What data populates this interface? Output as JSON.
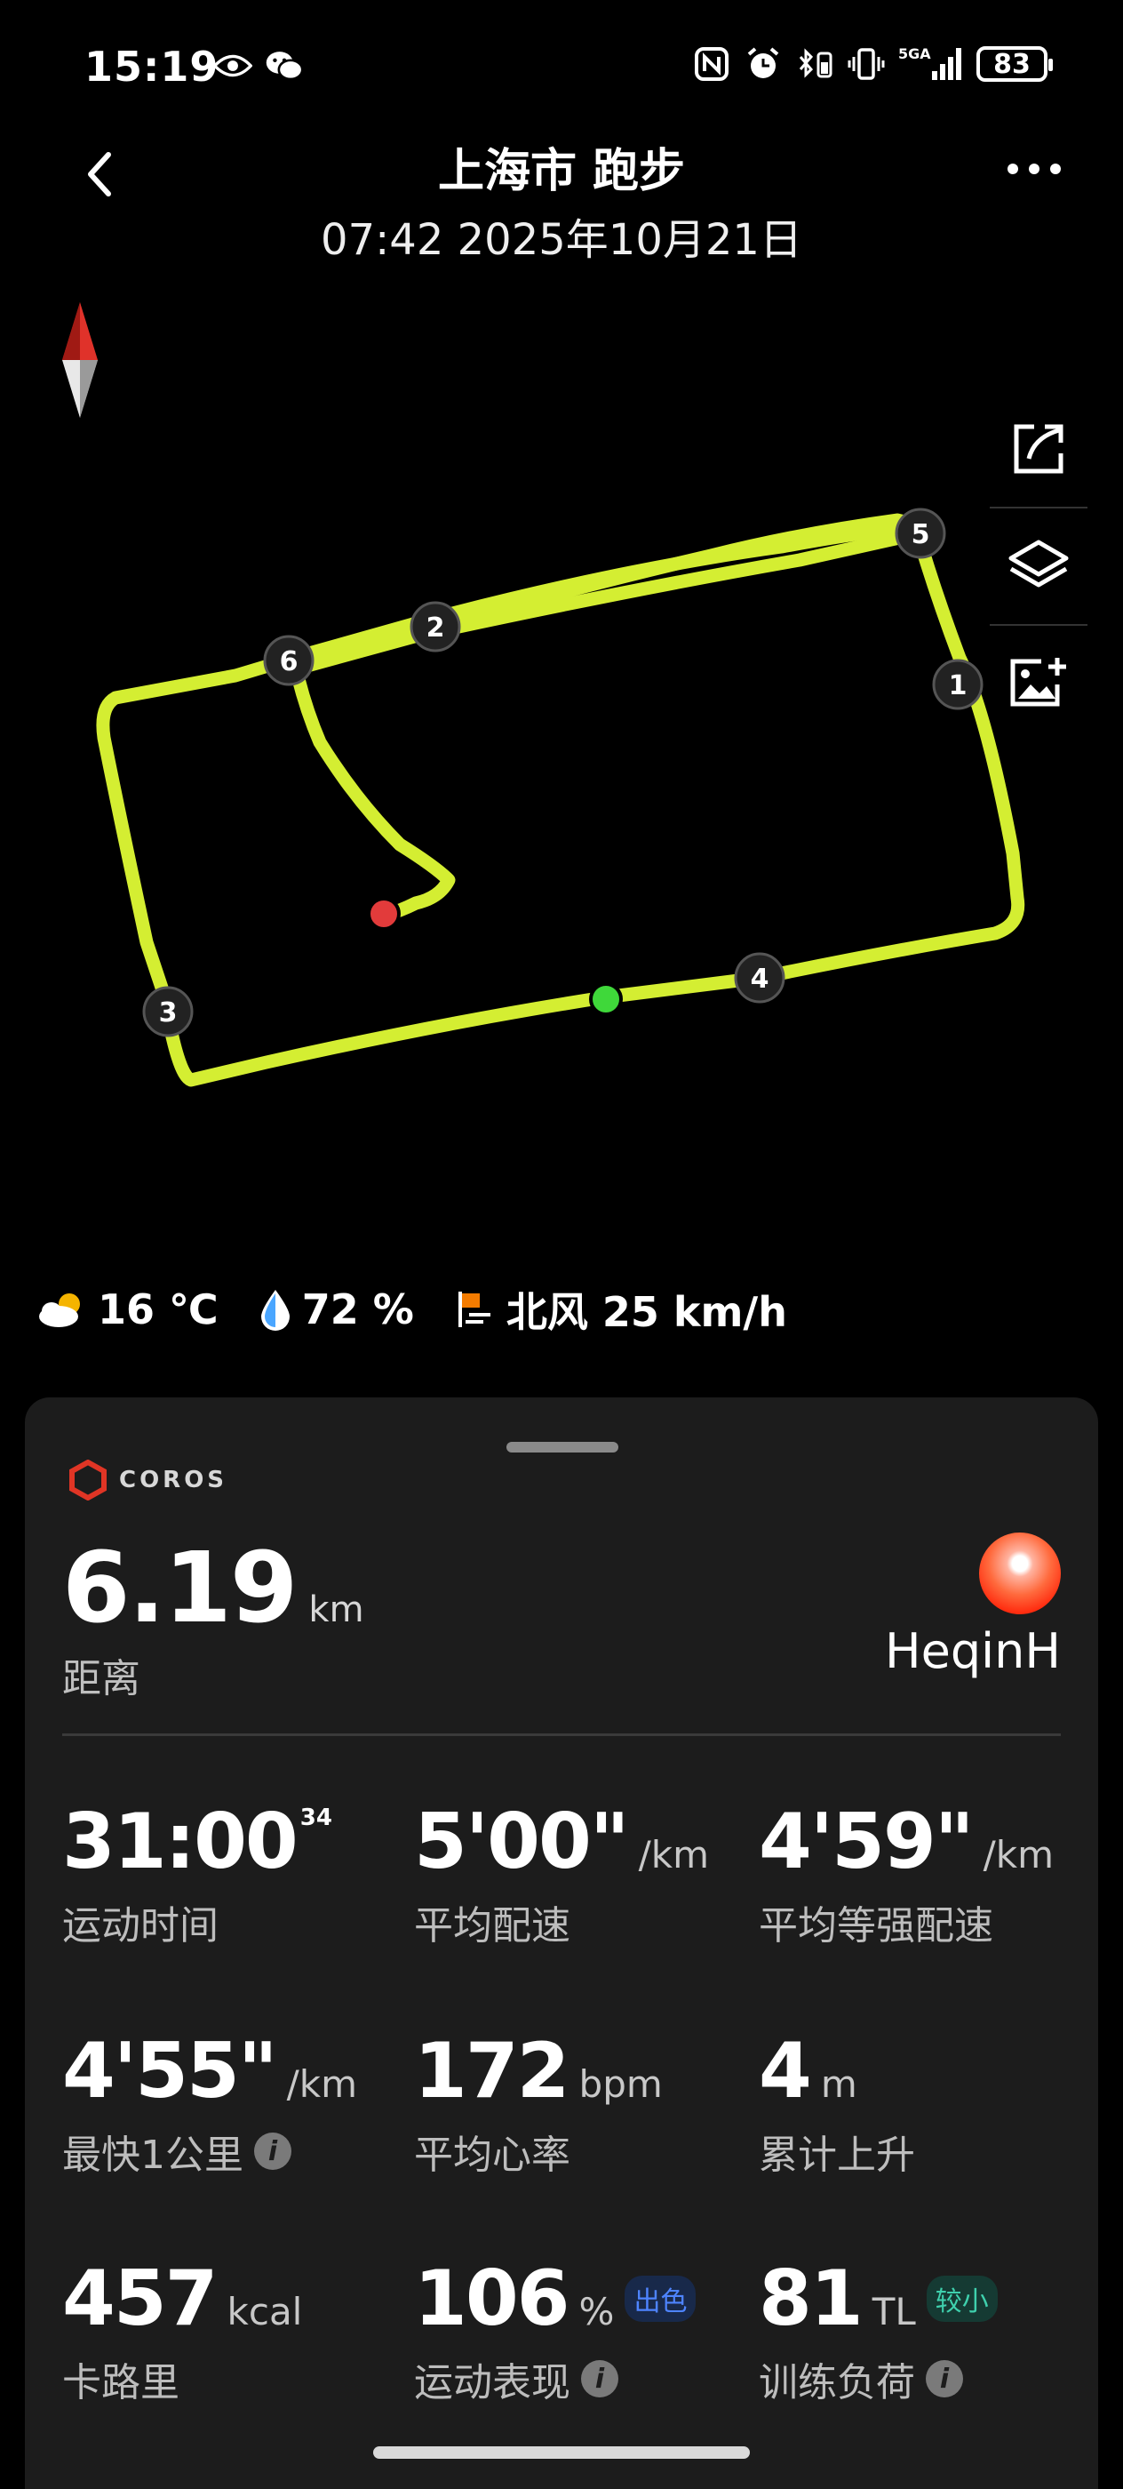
{
  "status": {
    "time": "15:19",
    "battery": "83",
    "network": "5GA"
  },
  "header": {
    "title": "上海市 跑步",
    "subtitle": "07:42 2025年10月21日"
  },
  "map": {
    "route_color": "#d4ee32",
    "start_color": "#3fd83a",
    "end_color": "#e23b3b",
    "markers": [
      "1",
      "2",
      "3",
      "4",
      "5",
      "6"
    ],
    "tools": [
      "share-icon",
      "layers-icon",
      "add-photo-icon"
    ]
  },
  "weather": {
    "temp": "16 ℃",
    "humidity": "72 %",
    "wind": "北风 25 km/h"
  },
  "card": {
    "brand": "COROS",
    "distance": "6.19",
    "distance_unit": "km",
    "distance_label": "距离",
    "username": "HeqinH",
    "stats": [
      {
        "value": "31:00",
        "sup": "34",
        "unit": "",
        "label": "运动时间"
      },
      {
        "value": "5'00\"",
        "unit": "/km",
        "label": "平均配速"
      },
      {
        "value": "4'59\"",
        "unit": "/km",
        "label": "平均等强配速"
      },
      {
        "value": "4'55\"",
        "unit": "/km",
        "label": "最快1公里"
      },
      {
        "value": "172",
        "unit": "bpm",
        "label": "平均心率"
      },
      {
        "value": "4",
        "unit": "m",
        "label": "累计上升"
      },
      {
        "value": "457",
        "unit": "kcal",
        "label": "卡路里"
      },
      {
        "value": "106",
        "unit": "%",
        "label": "运动表现",
        "badge": "出色"
      },
      {
        "value": "81",
        "unit": "TL",
        "label": "训练负荷",
        "badge": "较小"
      }
    ]
  }
}
